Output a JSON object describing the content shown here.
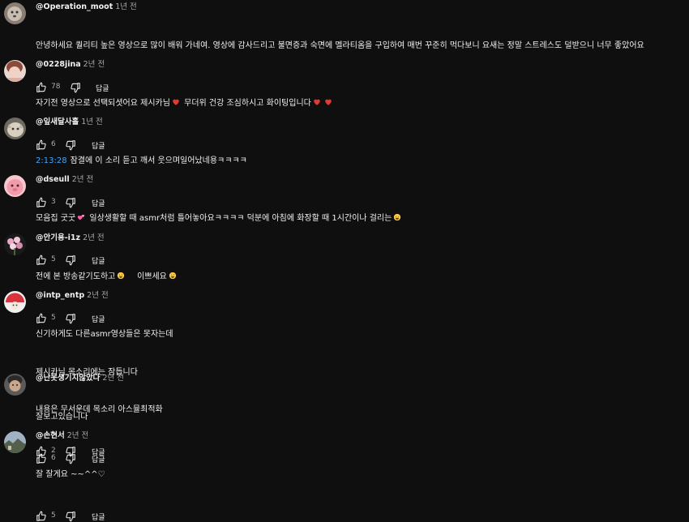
{
  "comments": [
    {
      "author": "@Operation_moot",
      "time": "1년 전",
      "lines": [
        "안녕하세요 퀄리티 높은 영상으로  많이 배워 가네여. 영상에 감사드리고 불면증과 숙면에 멜라티옴을 구입하여 매번 꾸준히 먹다보니 요새는 정말 스트레스도 덜받으니 너무 좋았어요"
      ],
      "likes": "78",
      "reply": "답글",
      "avatar": "avatar-dog-photo"
    },
    {
      "author": "@0228jina",
      "time": "2년 전",
      "lines": [
        "자기전 영상으로 선택되셧어요 제시카님",
        "무더위 건강 조심하시고 화이팅입니다"
      ],
      "likes": "6",
      "reply": "답글",
      "avatar": "avatar-person-photo"
    },
    {
      "author": "@잎새달사흘",
      "time": "1년 전",
      "timestamp": "2:13:28",
      "lines": [
        "잠결에 이 소리 듣고 깨서 웃으며일어났네용ㅋㅋㅋㅋ"
      ],
      "likes": "3",
      "reply": "답글",
      "avatar": "avatar-cat-photo"
    },
    {
      "author": "@dseull",
      "time": "2년 전",
      "lines": [
        "모음집 굿굿",
        "일상생활할 때 asmr처럼 틀어놓아요ㅋㅋㅋㅋ 덕분에 아침에 화장할 때 1시간이나 걸리는"
      ],
      "likes": "5",
      "reply": "답글",
      "avatar": "avatar-pink-character"
    },
    {
      "author": "@안기용-i1z",
      "time": "2년 전",
      "lines": [
        "전에 본 방송같기도하고",
        "이쁘세요"
      ],
      "likes": "5",
      "reply": "답글",
      "avatar": "avatar-flowers"
    },
    {
      "author": "@intp_entp",
      "time": "2년 전",
      "lines": [
        "신기하게도 다른asmr영상들은 못자는데",
        "제시카님 목소리에는 잠듭니다",
        "내용은 무서운데 목소리 아스뮬최적화"
      ],
      "likes": "2",
      "reply": "답글",
      "avatar": "avatar-red-character"
    },
    {
      "author": "@난못생기지않았다",
      "time": "2년 전",
      "lines": [
        "잘보고있습니다"
      ],
      "likes": "6",
      "reply": "답글",
      "avatar": "avatar-face-photo"
    },
    {
      "author": "@손현서",
      "time": "2년 전",
      "lines": [
        "잘 잘게요 ~~^^♡"
      ],
      "likes": "5",
      "reply": "답글",
      "avatar": "avatar-landscape-photo"
    }
  ],
  "colors": {
    "background": "#0f0f0f",
    "text": "#f1f1f1",
    "secondary": "#aaaaaa",
    "timestamp_link": "#3ea6ff",
    "heart": "#e53935"
  }
}
